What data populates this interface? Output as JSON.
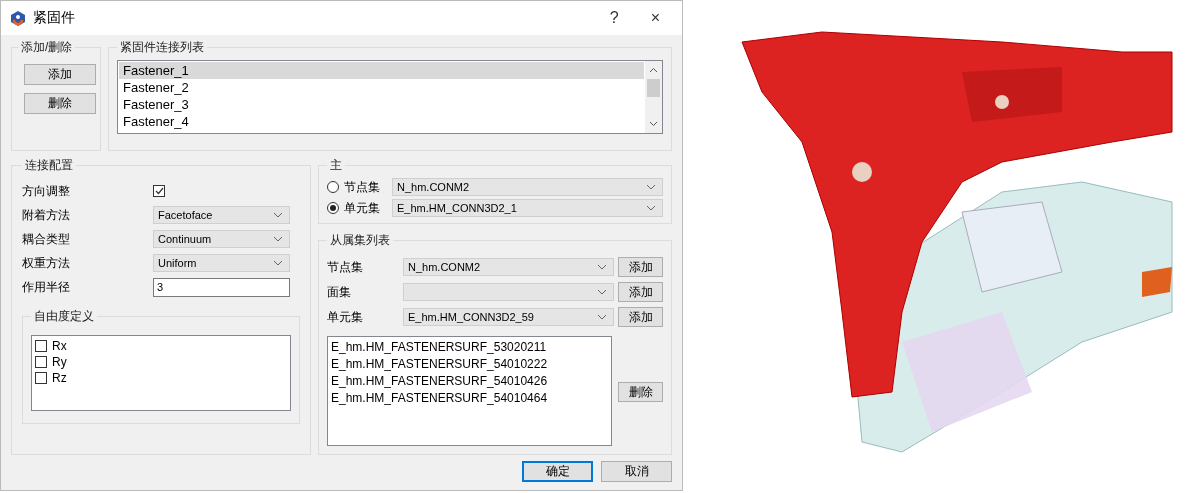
{
  "window": {
    "title": "紧固件",
    "help": "?",
    "close": "×"
  },
  "add_remove": {
    "title": "添加/删除",
    "buttons": [
      "添加",
      "删除"
    ]
  },
  "fastener_list": {
    "title": "紧固件连接列表",
    "items": [
      {
        "label": "Fastener_1",
        "selected": true
      },
      {
        "label": "Fastener_2",
        "selected": false
      },
      {
        "label": "Fastener_3",
        "selected": false
      },
      {
        "label": "Fastener_4",
        "selected": false
      }
    ]
  },
  "connection_config": {
    "title": "连接配置",
    "fields": [
      {
        "kind": "checkbox",
        "label": "方向调整",
        "checked": true
      },
      {
        "kind": "dropdown",
        "label": "附着方法",
        "value": "Facetoface"
      },
      {
        "kind": "dropdown",
        "label": "耦合类型",
        "value": "Continuum"
      },
      {
        "kind": "dropdown",
        "label": "权重方法",
        "value": "Uniform"
      },
      {
        "kind": "input",
        "label": "作用半径",
        "value": "3"
      }
    ],
    "dof": {
      "title": "自由度定义",
      "items": [
        {
          "label": "Rx",
          "checked": false
        },
        {
          "label": "Ry",
          "checked": false
        },
        {
          "label": "Rz",
          "checked": false
        }
      ]
    }
  },
  "master": {
    "title": "主",
    "options": [
      {
        "label": "节点集",
        "selected": false,
        "value": "N_hm.CONM2"
      },
      {
        "label": "单元集",
        "selected": true,
        "value": "E_hm.HM_CONN3D2_1"
      }
    ]
  },
  "slave_list": {
    "title": "从属集列表",
    "rows": [
      {
        "label": "节点集",
        "value": "N_hm.CONM2",
        "button": "添加"
      },
      {
        "label": "面集",
        "button": "添加"
      },
      {
        "label": "单元集",
        "value": "E_hm.HM_CONN3D2_59",
        "button": "添加"
      }
    ],
    "items": [
      "E_hm.HM_FASTENERSURF_53020211",
      "E_hm.HM_FASTENERSURF_54010222",
      "E_hm.HM_FASTENERSURF_54010426",
      "E_hm.HM_FASTENERSURF_54010464"
    ],
    "delete_button": "删除"
  },
  "footer": {
    "buttons": [
      {
        "label": "确定",
        "focused": true
      },
      {
        "label": "取消",
        "focused": false
      }
    ]
  }
}
